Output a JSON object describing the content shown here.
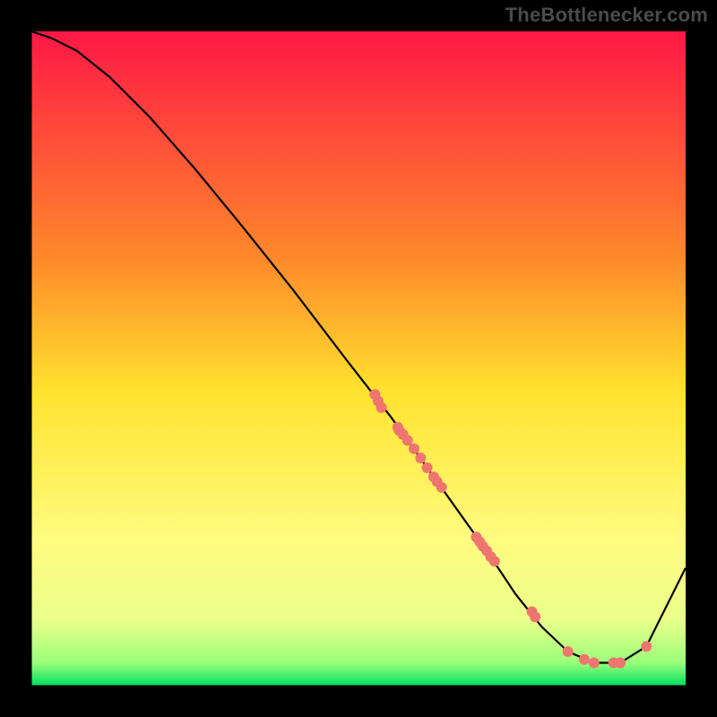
{
  "watermark": "TheBottlenecker.com",
  "chart_data": {
    "type": "line",
    "title": "",
    "xlabel": "",
    "ylabel": "",
    "xlim": [
      0,
      100
    ],
    "ylim": [
      0,
      100
    ],
    "background_gradient": {
      "stops": [
        {
          "offset": 0,
          "color": "#ff1846"
        },
        {
          "offset": 0.35,
          "color": "#ff8a2a"
        },
        {
          "offset": 0.55,
          "color": "#ffe22e"
        },
        {
          "offset": 0.78,
          "color": "#fffc80"
        },
        {
          "offset": 0.9,
          "color": "#eaff8a"
        },
        {
          "offset": 0.965,
          "color": "#9bff7a"
        },
        {
          "offset": 1.0,
          "color": "#00e060"
        }
      ]
    },
    "series": [
      {
        "name": "curve",
        "color": "#000000",
        "stroke_width": 2.2,
        "x": [
          0,
          3,
          7,
          12,
          18,
          25,
          32,
          40,
          48,
          55,
          60,
          65,
          70,
          74,
          78,
          82,
          86,
          90,
          94,
          100
        ],
        "y": [
          100,
          99,
          97,
          93,
          87,
          79,
          70.5,
          60.5,
          50,
          41,
          34,
          27,
          20,
          14,
          9,
          5.2,
          3.5,
          3.5,
          6,
          18
        ]
      }
    ],
    "scatter": {
      "name": "cluster-points",
      "color": "#ee766f",
      "radius": 6,
      "points": [
        {
          "x": 52.5,
          "y": 44.5
        },
        {
          "x": 53.0,
          "y": 43.5
        },
        {
          "x": 53.5,
          "y": 42.5
        },
        {
          "x": 56.0,
          "y": 39.5
        },
        {
          "x": 56.2,
          "y": 39.0
        },
        {
          "x": 56.8,
          "y": 38.4
        },
        {
          "x": 57.5,
          "y": 37.5
        },
        {
          "x": 58.5,
          "y": 36.2
        },
        {
          "x": 59.5,
          "y": 34.8
        },
        {
          "x": 60.5,
          "y": 33.3
        },
        {
          "x": 61.5,
          "y": 31.9
        },
        {
          "x": 62.0,
          "y": 31.2
        },
        {
          "x": 62.7,
          "y": 30.3
        },
        {
          "x": 68.0,
          "y": 22.7
        },
        {
          "x": 68.5,
          "y": 22.0
        },
        {
          "x": 69.0,
          "y": 21.3
        },
        {
          "x": 69.6,
          "y": 20.6
        },
        {
          "x": 70.2,
          "y": 19.7
        },
        {
          "x": 70.8,
          "y": 19.0
        },
        {
          "x": 76.5,
          "y": 11.3
        },
        {
          "x": 77.0,
          "y": 10.5
        },
        {
          "x": 82.0,
          "y": 5.2
        },
        {
          "x": 84.5,
          "y": 4.0
        },
        {
          "x": 86.0,
          "y": 3.5
        },
        {
          "x": 89.0,
          "y": 3.5
        },
        {
          "x": 90.0,
          "y": 3.5
        },
        {
          "x": 94.0,
          "y": 6.0
        }
      ]
    },
    "grid": false,
    "legend": false
  }
}
